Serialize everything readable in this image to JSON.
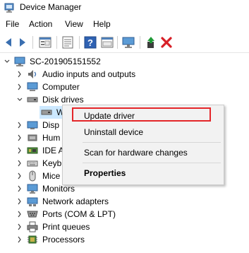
{
  "window": {
    "title": "Device Manager"
  },
  "menu": {
    "items": [
      "File",
      "Action",
      "View",
      "Help"
    ]
  },
  "toolbar": {
    "icons": [
      "back-arrow-icon",
      "forward-arrow-icon",
      "properties-icon",
      "refresh-list-icon",
      "help-icon",
      "driver-properties-icon",
      "monitor-scan-icon",
      "update-driver-icon",
      "uninstall-icon"
    ],
    "colors": {
      "arrow": "#3a6fb0",
      "remove": "#d71f27",
      "update": "#1f9a36"
    }
  },
  "tree": {
    "root": "SC-201905151552",
    "nodes": [
      {
        "label": "Audio inputs and outputs",
        "expanded": false
      },
      {
        "label": "Computer",
        "expanded": false
      },
      {
        "label": "Disk drives",
        "expanded": true
      },
      {
        "label": "W",
        "child": true
      },
      {
        "label": "Disp",
        "expanded": false
      },
      {
        "label": "Hum",
        "expanded": false
      },
      {
        "label": "IDE A",
        "expanded": false
      },
      {
        "label": "Keyb",
        "expanded": false
      },
      {
        "label": "Mice",
        "expanded": false
      },
      {
        "label": "Monitors",
        "expanded": false
      },
      {
        "label": "Network adapters",
        "expanded": false
      },
      {
        "label": "Ports (COM & LPT)",
        "expanded": false
      },
      {
        "label": "Print queues",
        "expanded": false
      },
      {
        "label": "Processors",
        "expanded": false
      }
    ]
  },
  "context_menu": {
    "items": [
      {
        "label": "Update driver",
        "highlighted": true
      },
      {
        "label": "Uninstall device"
      },
      {
        "label": "Scan for hardware changes"
      },
      {
        "label": "Properties",
        "bold": true
      }
    ],
    "highlight_color": "#e4262a"
  }
}
